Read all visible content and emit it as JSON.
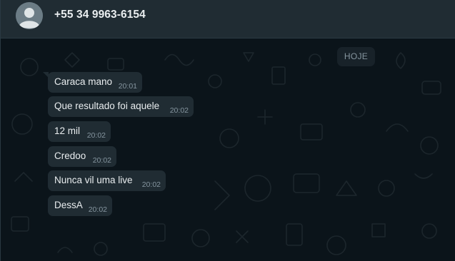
{
  "header": {
    "contact_name": "+55 34 9963-6154",
    "avatar_icon": "default-avatar-icon"
  },
  "chat": {
    "date_chip": "HOJE",
    "messages": [
      {
        "text": "Caraca mano",
        "time": "20:01"
      },
      {
        "text": "Que resultado foi aquele",
        "time": "20:02"
      },
      {
        "text": "12 mil",
        "time": "20:02"
      },
      {
        "text": "Credoo",
        "time": "20:02"
      },
      {
        "text": "Nunca vil uma live",
        "time": "20:02"
      },
      {
        "text": "DessA",
        "time": "20:02"
      }
    ]
  },
  "colors": {
    "header_bg": "#202c33",
    "chat_bg": "#0b141a",
    "bubble_bg": "#202c33",
    "text_primary": "#e9edef",
    "text_secondary": "#8696a0"
  }
}
